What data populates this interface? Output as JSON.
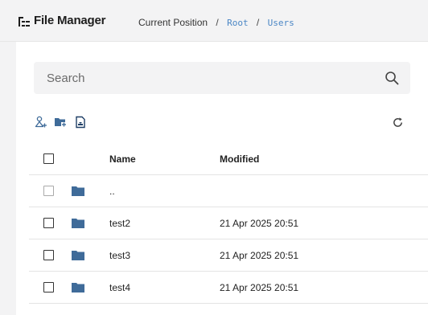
{
  "app": {
    "title": "File Manager"
  },
  "breadcrumb": {
    "label": "Current Position",
    "separator": "/",
    "items": [
      "Root",
      "Users"
    ]
  },
  "search": {
    "placeholder": "Search",
    "icon": "search-icon"
  },
  "toolbar": {
    "icons": [
      "add-user-icon",
      "new-folder-icon",
      "upload-file-icon"
    ],
    "refresh_icon": "refresh-icon"
  },
  "table": {
    "columns": [
      "Name",
      "Modified"
    ],
    "rows": [
      {
        "name": "..",
        "modified": ""
      },
      {
        "name": "test2",
        "modified": "21 Apr 2025 20:51"
      },
      {
        "name": "test3",
        "modified": "21 Apr 2025 20:51"
      },
      {
        "name": "test4",
        "modified": "21 Apr 2025 20:51"
      }
    ]
  },
  "colors": {
    "accent": "#4a86c5",
    "folder": "#3f6b99",
    "topbar_bg": "#f3f3f4"
  }
}
